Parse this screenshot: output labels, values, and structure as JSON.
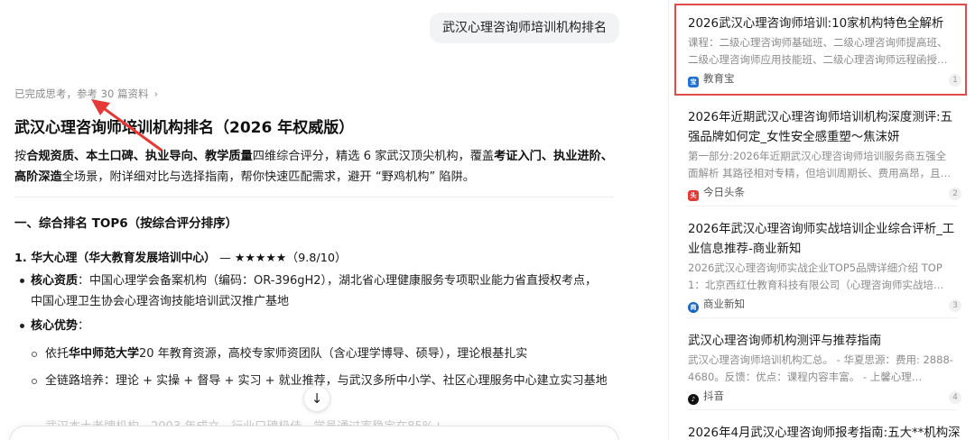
{
  "chat": {
    "query": "武汉心理咨询师培训机构排名",
    "thinking_text": "已完成思考，参考 30 篇资料",
    "answer_title": "武汉心理咨询师培训机构排名（2026 年权威版）",
    "intro": {
      "p1": "按",
      "b1": "合规资质、本土口碑、执业导向、教学质量",
      "p2": "四维综合评分，精选 6 家武汉顶尖机构，覆盖",
      "b2": "考证入门、执业进阶、高阶深造",
      "p3": "全场景，附详细对比与选择指南，帮你快速匹配需求，避开 “野鸡机构” 陷阱。"
    },
    "section_heading": "一、综合排名 TOP6（按综合评分排序）",
    "rank1": {
      "name": "1. 华大心理（华大教育发展培训中心）",
      "rating": " — ★★★★★（9.8/10）"
    },
    "qual_label": "核心资质",
    "qual_text": "：中国心理学会备案机构（编码：OR-396gH2），湖北省心理健康服务专项职业能力省直授权考点，中国心理卫生协会心理咨询技能培训武汉推广基地",
    "adv_label": "核心优势",
    "adv_colon": "：",
    "adv1_pre": "依托",
    "adv1_bold": "华中师范大学",
    "adv1_post": "20 年教育资源，高校专家师资团队（含心理学博导、硕导），理论根基扎实",
    "adv2": "全链路培养：理论 + 实操 + 督导 + 实习 + 就业推荐，与武汉多所中小学、社区心理服务中心建立实习基地",
    "faded_line": "武汉本土老牌机构，2003 年成立，行业口碑极佳，学员通过率稳定在85%+"
  },
  "sources": [
    {
      "title": "2026武汉心理咨询师培训:10家机构特色全解析",
      "snippet": "课程：二级心理咨询师基础班、二级心理咨询师提高班、二级心理咨询师应用技能班、二级心理咨询师远程函授…",
      "site": "教育宝",
      "index": "1",
      "icon_color": "#1e6fd9"
    },
    {
      "title": "2026年近期武汉心理咨询师培训机构深度测评:五强品牌如何定_女性安全感重塑～焦沫妍",
      "snippet": "第一部分:2026年近期武汉心理咨询师培训服务商五强全面解析 其路径相对专精，但培训周期长、费用高昂，且跨流…",
      "site": "今日头条",
      "index": "2",
      "icon_color": "#e53935"
    },
    {
      "title": "2026年武汉心理咨询师实战培训企业综合评析_工业信息推荐-商业新知",
      "snippet": "2026武汉心理咨询师实战企业TOP5品牌详细介绍 TOP 1：北京西红仕教育科技有限公司（心理咨询师实战培…",
      "site": "商业新知",
      "index": "3",
      "icon_color": "#1565c0"
    },
    {
      "title": "武汉心理咨询师机构测评与推荐指南",
      "snippet": "武汉心理咨询师培训机构汇总。 - 华夏思源：费用: 2888-4680。反馈：优点：课程内容丰富。 - 上馨心理…",
      "site": "抖音",
      "index": "4",
      "icon_color": "#111111"
    },
    {
      "title": "2026年4月武汉心理咨询师报考指南:五大**机构深",
      "snippet": "",
      "site": "",
      "index": "",
      "icon_color": "#cccccc"
    }
  ],
  "colors": {
    "highlight": "#e24b4b",
    "annotation_arrow": "#e53935"
  }
}
